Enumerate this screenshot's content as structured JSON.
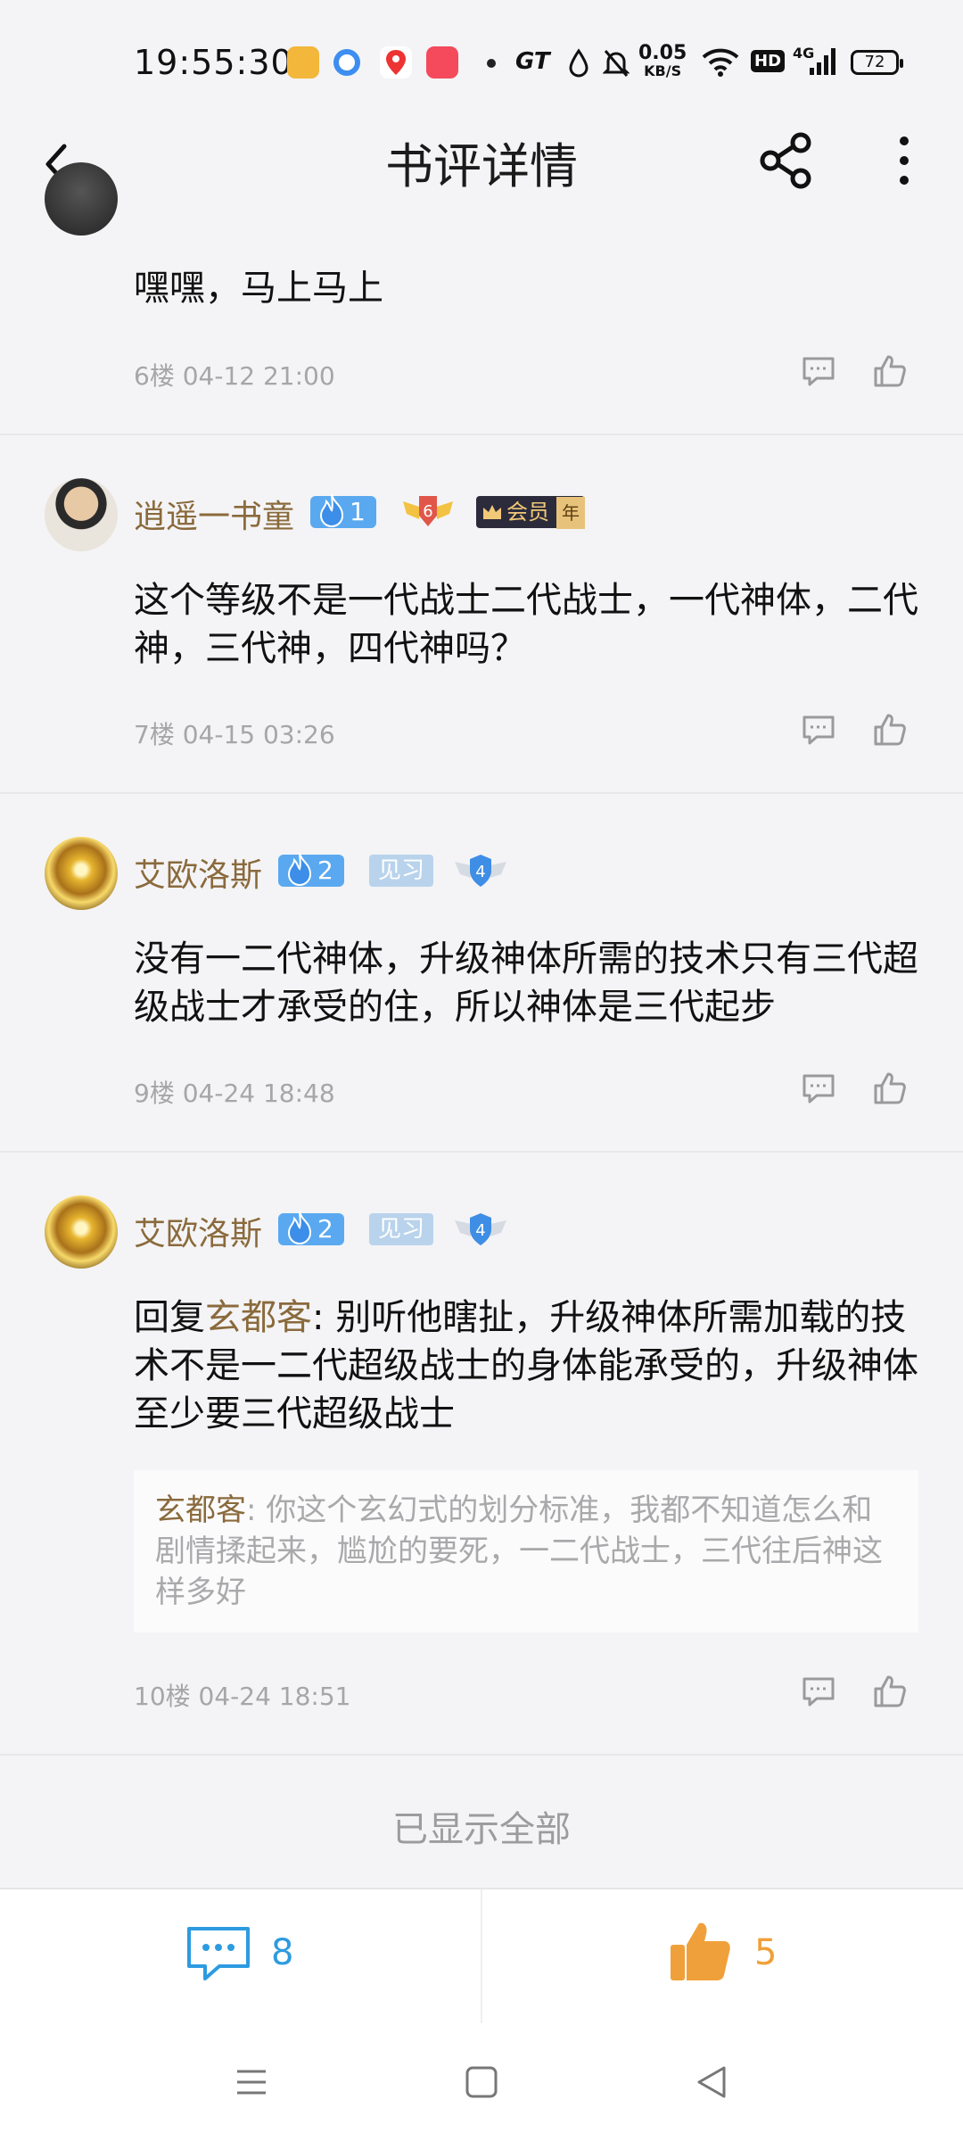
{
  "status_bar": {
    "time": "19:55:30",
    "network_speed_value": "0.05",
    "network_speed_unit": "KB/S",
    "gt_label": "GT",
    "hd_label": "HD",
    "network_type": "4G",
    "battery": "72"
  },
  "header": {
    "title": "书评详情"
  },
  "comments": [
    {
      "text": "嘿嘿，马上马上",
      "meta": "6楼 04-12 21:00"
    },
    {
      "username": "逍遥一书童",
      "fan_level": "1",
      "medal_level": "6",
      "member_label": "会员",
      "member_year": "年",
      "text": "这个等级不是一代战士二代战士，一代神体，二代神，三代神，四代神吗？",
      "meta": "7楼 04-15 03:26"
    },
    {
      "username": "艾欧洛斯",
      "fan_level": "2",
      "title_badge": "见习",
      "shield_level": "4",
      "text": "没有一二代神体，升级神体所需的技术只有三代超级战士才承受的住，所以神体是三代起步",
      "meta": "9楼 04-24 18:48"
    },
    {
      "username": "艾欧洛斯",
      "fan_level": "2",
      "title_badge": "见习",
      "shield_level": "4",
      "reply_prefix": "回复",
      "reply_to": "玄都客",
      "reply_sep": ": ",
      "text": "别听他瞎扯，升级神体所需加载的技术不是一二代超级战士的身体能承受的，升级神体至少要三代超级战士",
      "quote_name": "玄都客",
      "quote_sep": ": ",
      "quote_text": "你这个玄幻式的划分标准，我都不知道怎么和剧情揉起来，尴尬的要死，一二代战士，三代往后神这样多好",
      "meta": "10楼 04-24 18:51"
    }
  ],
  "end_text": "已显示全部",
  "bottom_bar": {
    "comment_count": "8",
    "like_count": "5"
  },
  "colors": {
    "username": "#8a6a3c",
    "comment_blue": "#2d9be0",
    "like_orange": "#f0a03a"
  }
}
